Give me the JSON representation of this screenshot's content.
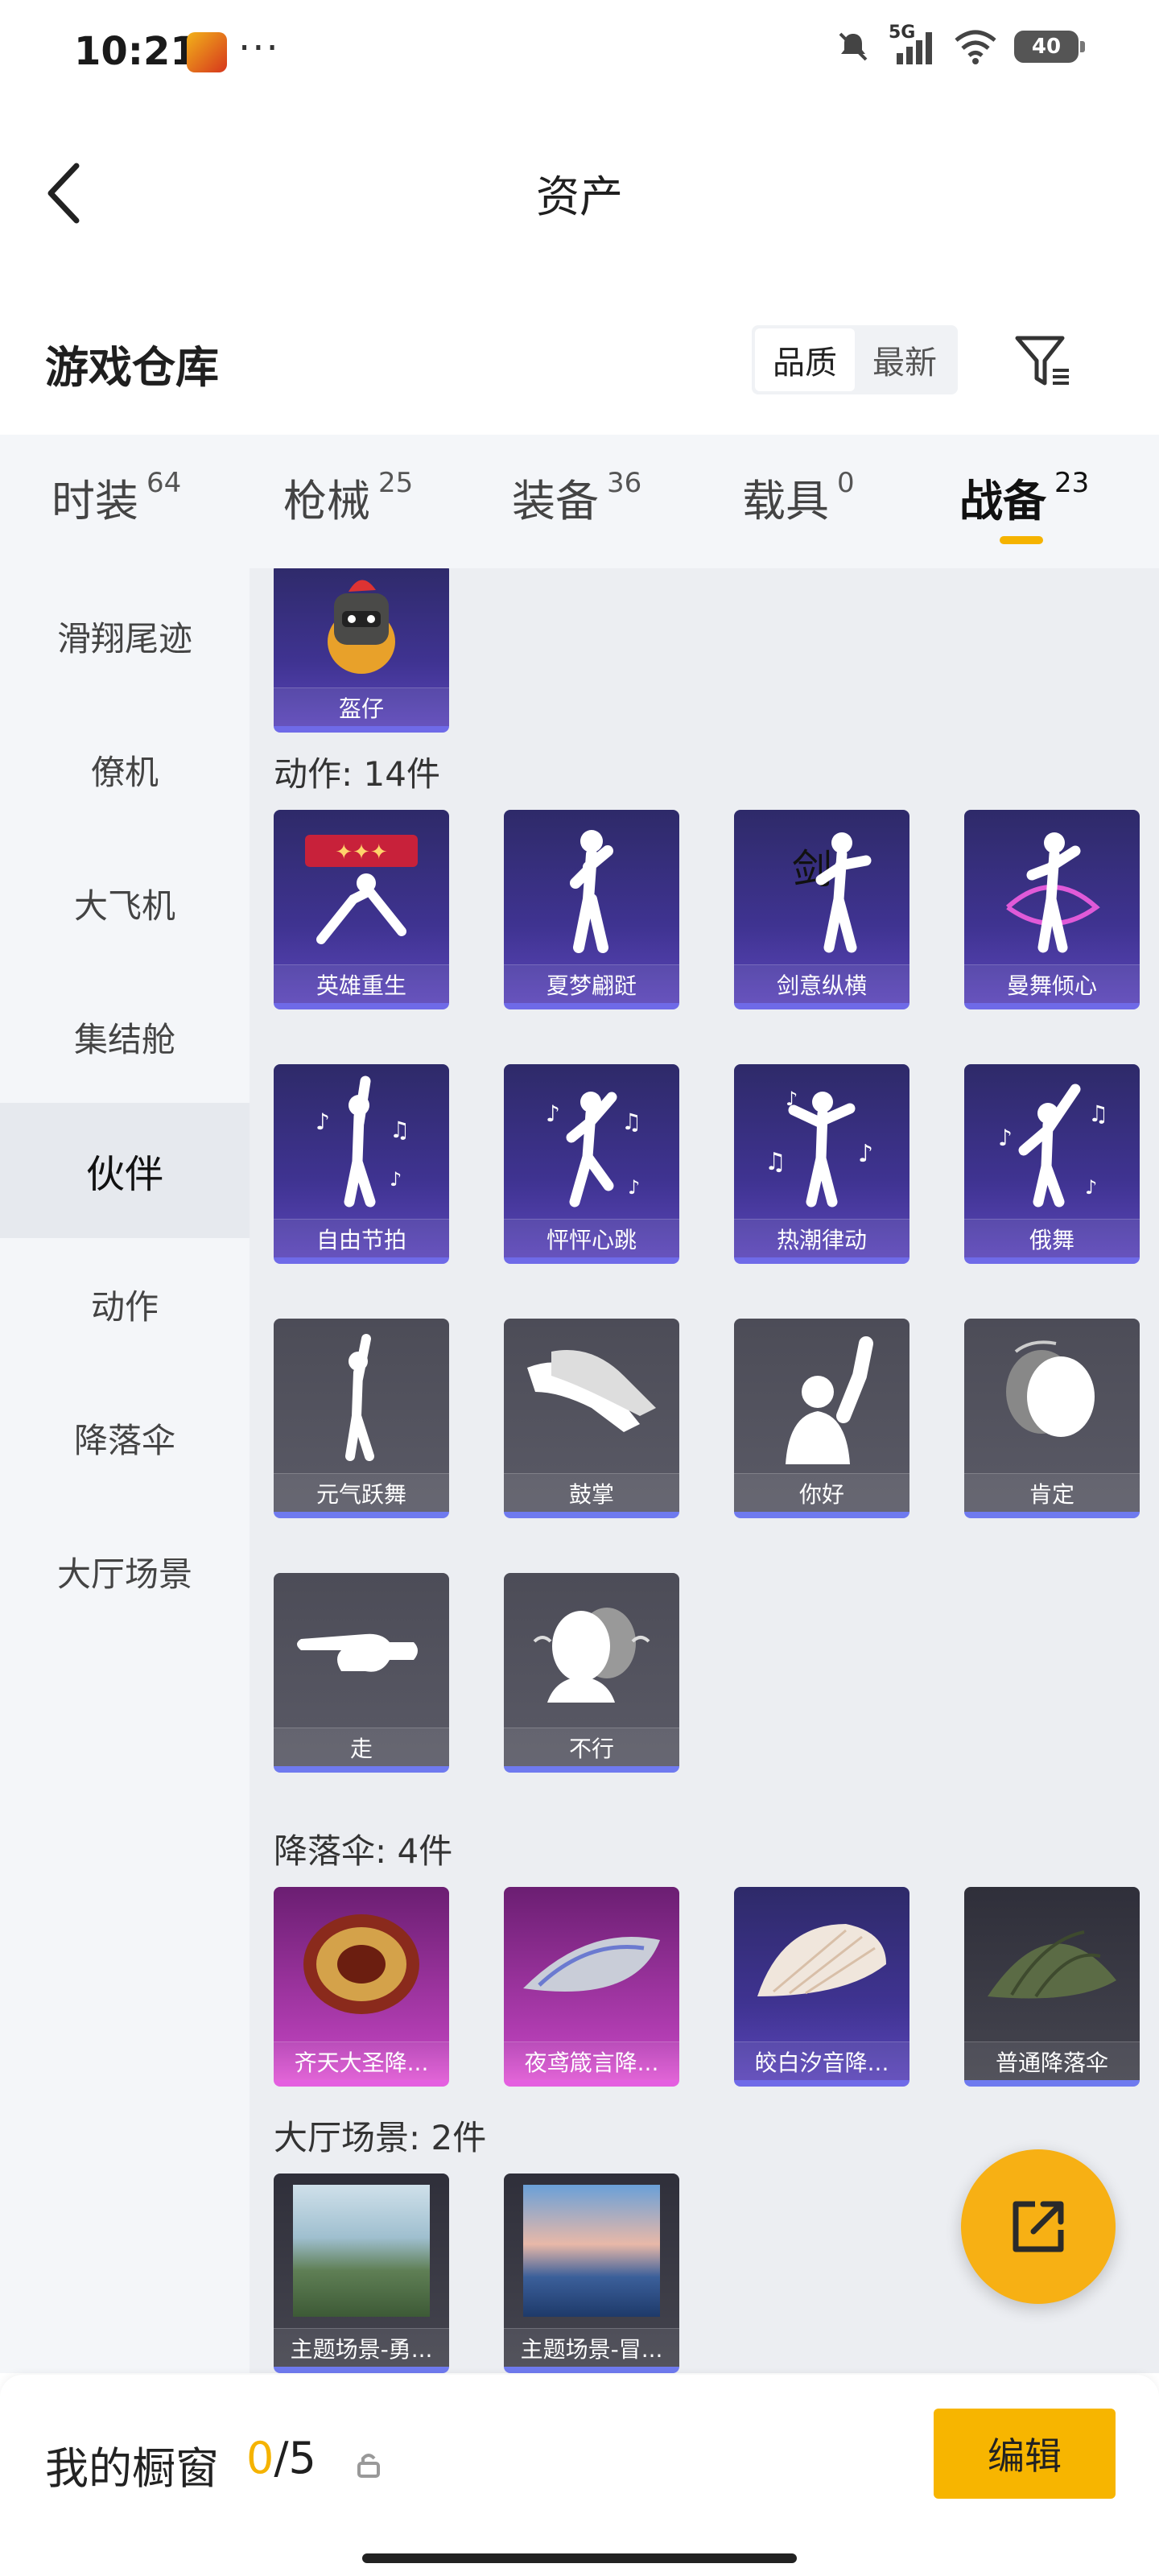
{
  "status_bar": {
    "time": "10:21",
    "dots": "···",
    "network": "5G",
    "battery": "40"
  },
  "header": {
    "title": "资产"
  },
  "warehouse": {
    "title": "游戏仓库",
    "sort_options": [
      "品质",
      "最新"
    ],
    "active_sort": "品质"
  },
  "categories": [
    {
      "label": "时装",
      "count": "64"
    },
    {
      "label": "枪械",
      "count": "25"
    },
    {
      "label": "装备",
      "count": "36"
    },
    {
      "label": "载具",
      "count": "0"
    },
    {
      "label": "战备",
      "count": "23"
    }
  ],
  "active_category": "战备",
  "sidebar": {
    "items": [
      "滑翔尾迹",
      "僚机",
      "大飞机",
      "集结舱",
      "伙伴",
      "动作",
      "降落伞",
      "大厅场景"
    ],
    "active": "伙伴"
  },
  "sections": {
    "partner_item": "盔仔",
    "actions": {
      "label": "动作: 14件",
      "items": [
        "英雄重生",
        "夏梦翩跹",
        "剑意纵横",
        "曼舞倾心",
        "自由节拍",
        "怦怦心跳",
        "热潮律动",
        "俄舞",
        "元气跃舞",
        "鼓掌",
        "你好",
        "肯定",
        "走",
        "不行"
      ]
    },
    "parachutes": {
      "label": "降落伞: 4件",
      "items": [
        "齐天大圣降...",
        "夜鸢箴言降...",
        "皎白汐音降...",
        "普通降落伞"
      ]
    },
    "lobby": {
      "label": "大厅场景: 2件",
      "items": [
        "主题场景-勇...",
        "主题场景-冒..."
      ]
    }
  },
  "bottom_bar": {
    "label": "我的橱窗",
    "current": "0",
    "total": "/5",
    "edit_label": "编辑"
  },
  "colors": {
    "accent": "#f5b300",
    "tile_purple": "#3f3391",
    "tile_gray": "#5a5a66",
    "tile_pink": "#b43eb4"
  }
}
